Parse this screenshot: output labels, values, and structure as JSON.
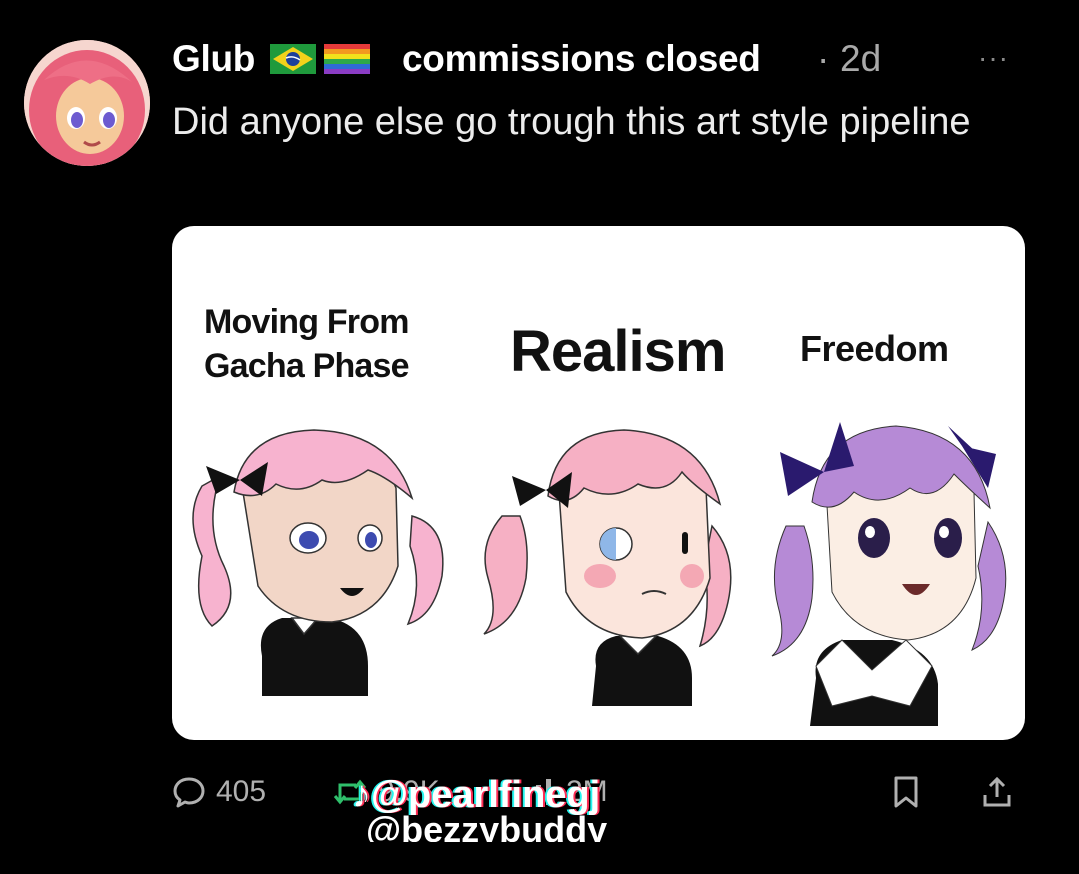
{
  "post": {
    "author": "Glub",
    "tagline": "commissions closed",
    "separator": "·",
    "time": "2d",
    "more": "···",
    "text": "Did anyone else go trough this art style pipeline"
  },
  "meme": {
    "labels": [
      "Moving From Gacha Phase",
      "Realism",
      "Freedom"
    ]
  },
  "actions": {
    "replies": "405",
    "reposts": "9.9K",
    "views": "2M"
  },
  "watermark": {
    "line1": "@pearlfinegj",
    "line2": "@bezzybuddy"
  },
  "colors": {
    "background": "#000000",
    "card": "#ffffff",
    "secondary_text": "#a9a9a9",
    "hair_pink": "#f7b3cf",
    "hair_purple": "#b68ad6",
    "bow_dark": "#2a1a6e"
  },
  "icons": [
    "brazil-flag-icon",
    "pride-flag-icon",
    "more-icon",
    "reply-icon",
    "repost-icon",
    "views-icon",
    "bookmark-icon",
    "share-icon",
    "tiktok-icon"
  ]
}
